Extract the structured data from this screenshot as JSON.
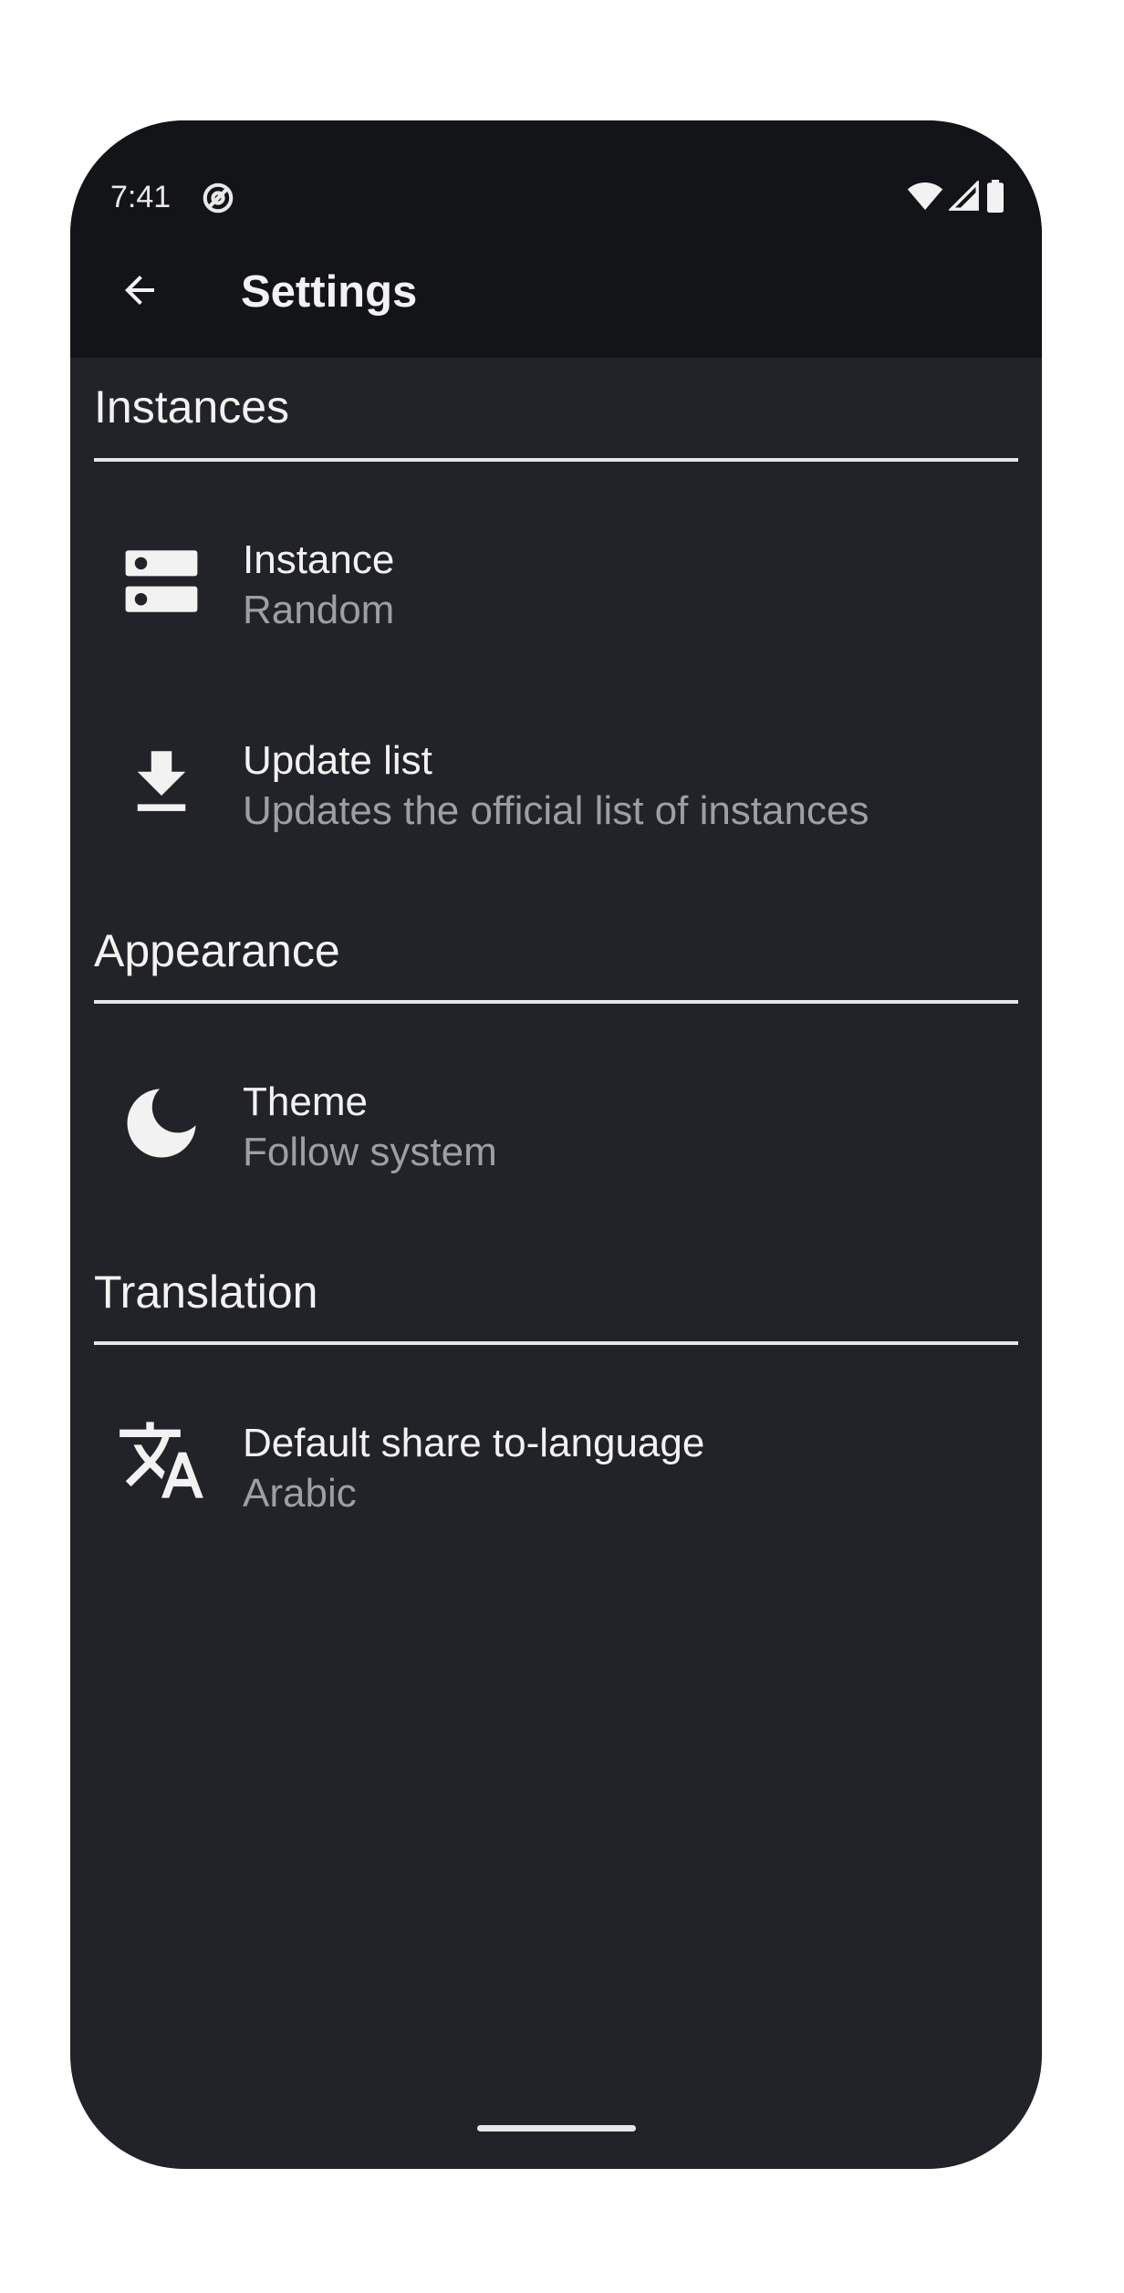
{
  "status_bar": {
    "time": "7:41",
    "app_icon": "at-sign-icon",
    "icons": [
      "wifi-icon",
      "signal-icon",
      "battery-icon"
    ]
  },
  "toolbar": {
    "back_icon": "arrow-back-icon",
    "title": "Settings"
  },
  "sections": {
    "instances": {
      "header": "Instances",
      "items": [
        {
          "icon": "server-icon",
          "title": "Instance",
          "summary": "Random"
        },
        {
          "icon": "download-icon",
          "title": "Update list",
          "summary": "Updates the official list of instances"
        }
      ]
    },
    "appearance": {
      "header": "Appearance",
      "items": [
        {
          "icon": "moon-icon",
          "title": "Theme",
          "summary": "Follow system"
        }
      ]
    },
    "translation": {
      "header": "Translation",
      "items": [
        {
          "icon": "translate-icon",
          "title": "Default share to-language",
          "summary": "Arabic"
        }
      ]
    }
  },
  "colors": {
    "background": "#212328",
    "toolbar": "#131417",
    "text_primary": "#f2f2f2",
    "text_secondary": "#9d9fa3",
    "divider": "#e6e6e6"
  }
}
